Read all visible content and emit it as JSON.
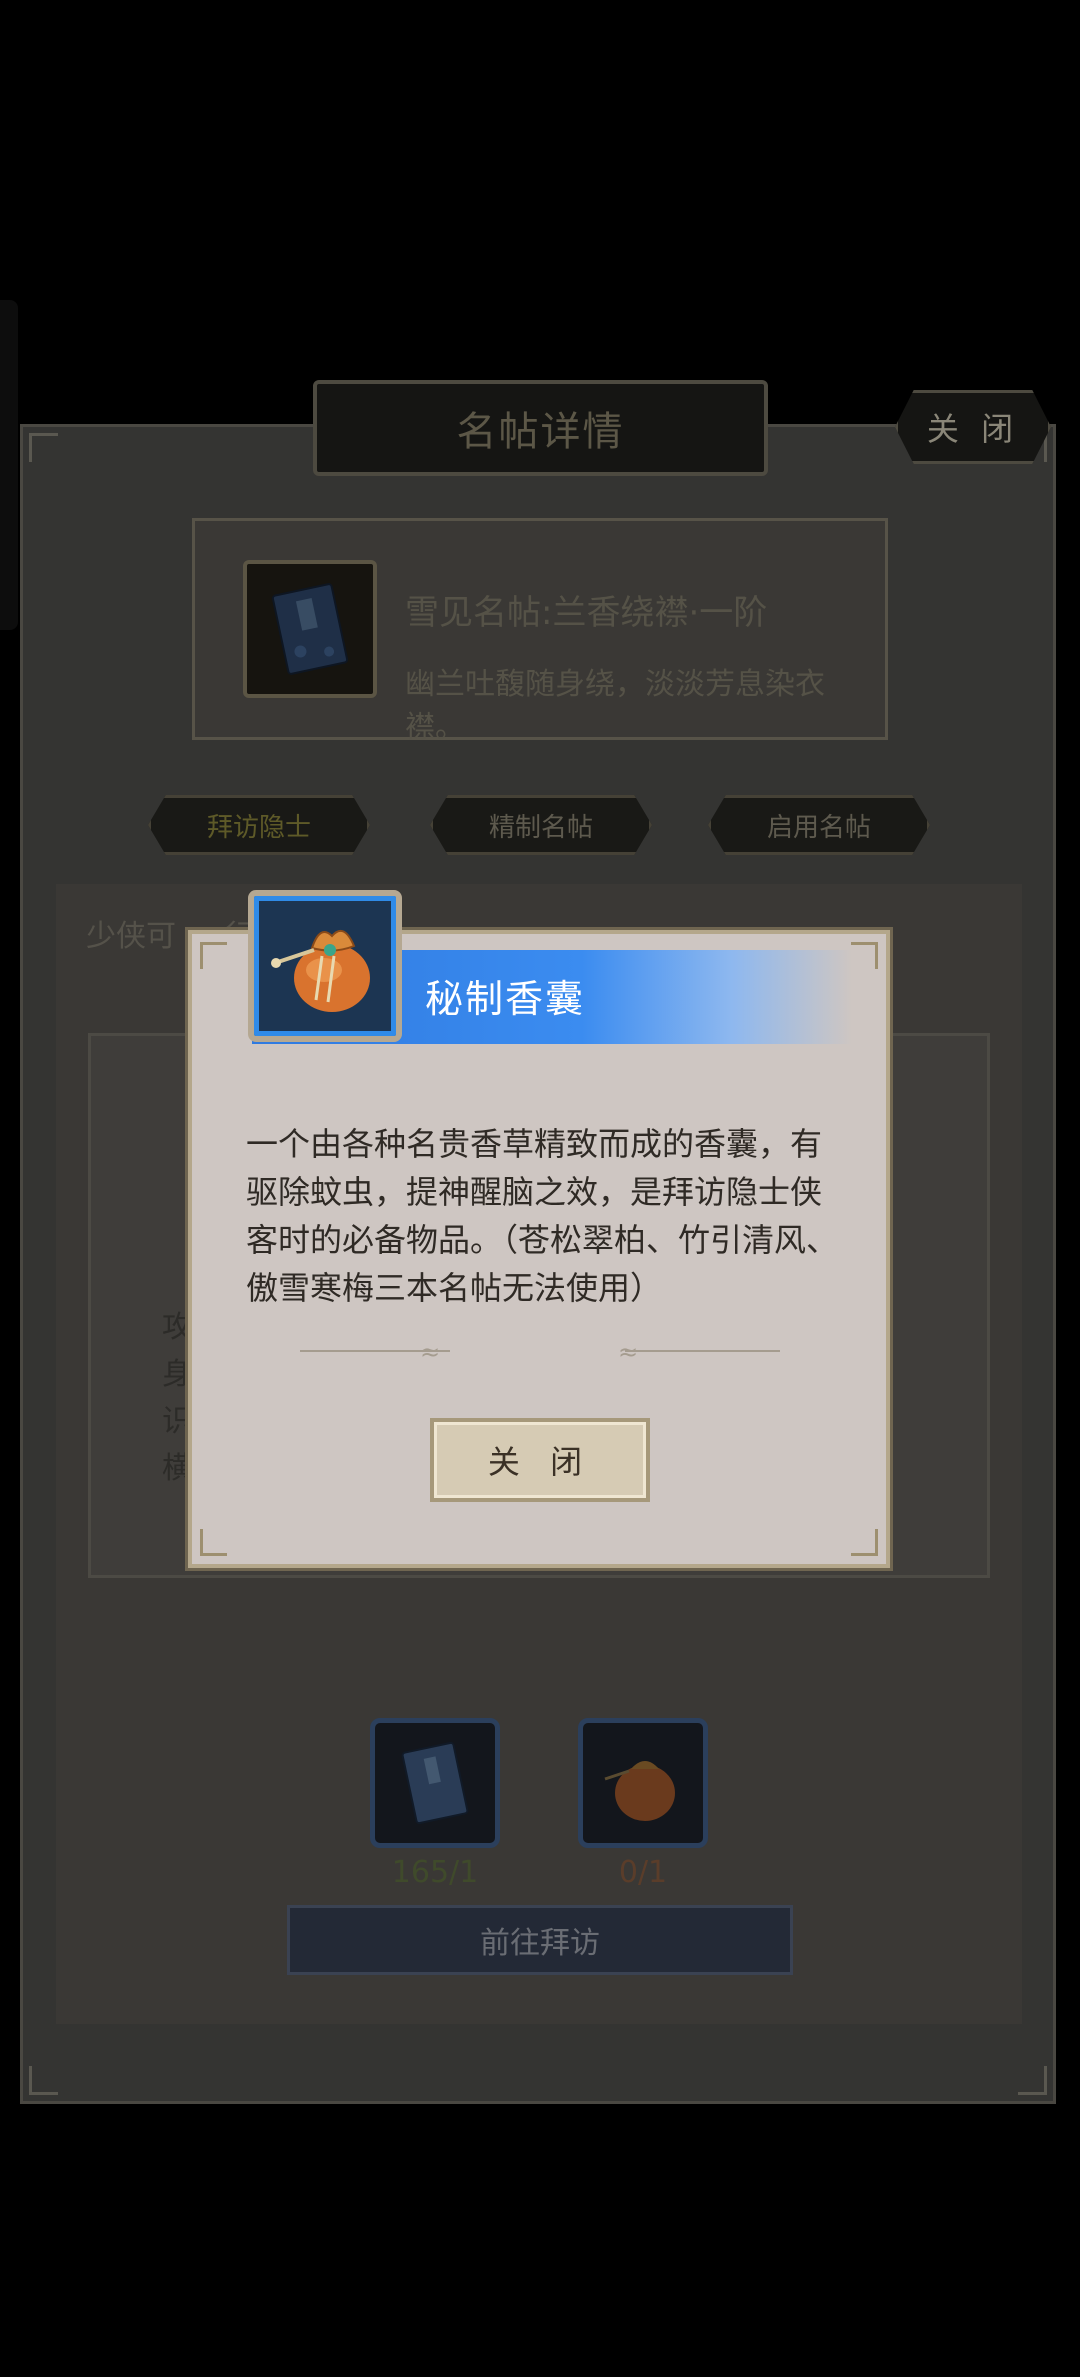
{
  "panel": {
    "title": "名帖详情",
    "close_label": "关 闭"
  },
  "card": {
    "name": "雪见名帖:兰香绕襟·一阶",
    "desc": "幽兰吐馥随身绕，淡淡芳息染衣襟。"
  },
  "tabs": [
    {
      "label": "拜访隐士"
    },
    {
      "label": "精制名帖"
    },
    {
      "label": "启用名帖"
    }
  ],
  "intro_text": "少侠可 … 行，提",
  "side_text": "攻身识横",
  "requirements": [
    {
      "count": "165/1"
    },
    {
      "count": "0/1"
    }
  ],
  "go_button": "前往拜访",
  "popup": {
    "title": "秘制香囊",
    "desc": "一个由各种名贵香草精致而成的香囊，有驱除蚊虫，提神醒脑之效，是拜访隐士侠客时的必备物品。（苍松翠柏、竹引清风、傲雪寒梅三本名帖无法使用）",
    "close_label": "关 闭"
  },
  "colors": {
    "popup_header": "#2f7ae0",
    "popup_bg": "#cec6c2",
    "frame_gold": "#b4a78b"
  }
}
